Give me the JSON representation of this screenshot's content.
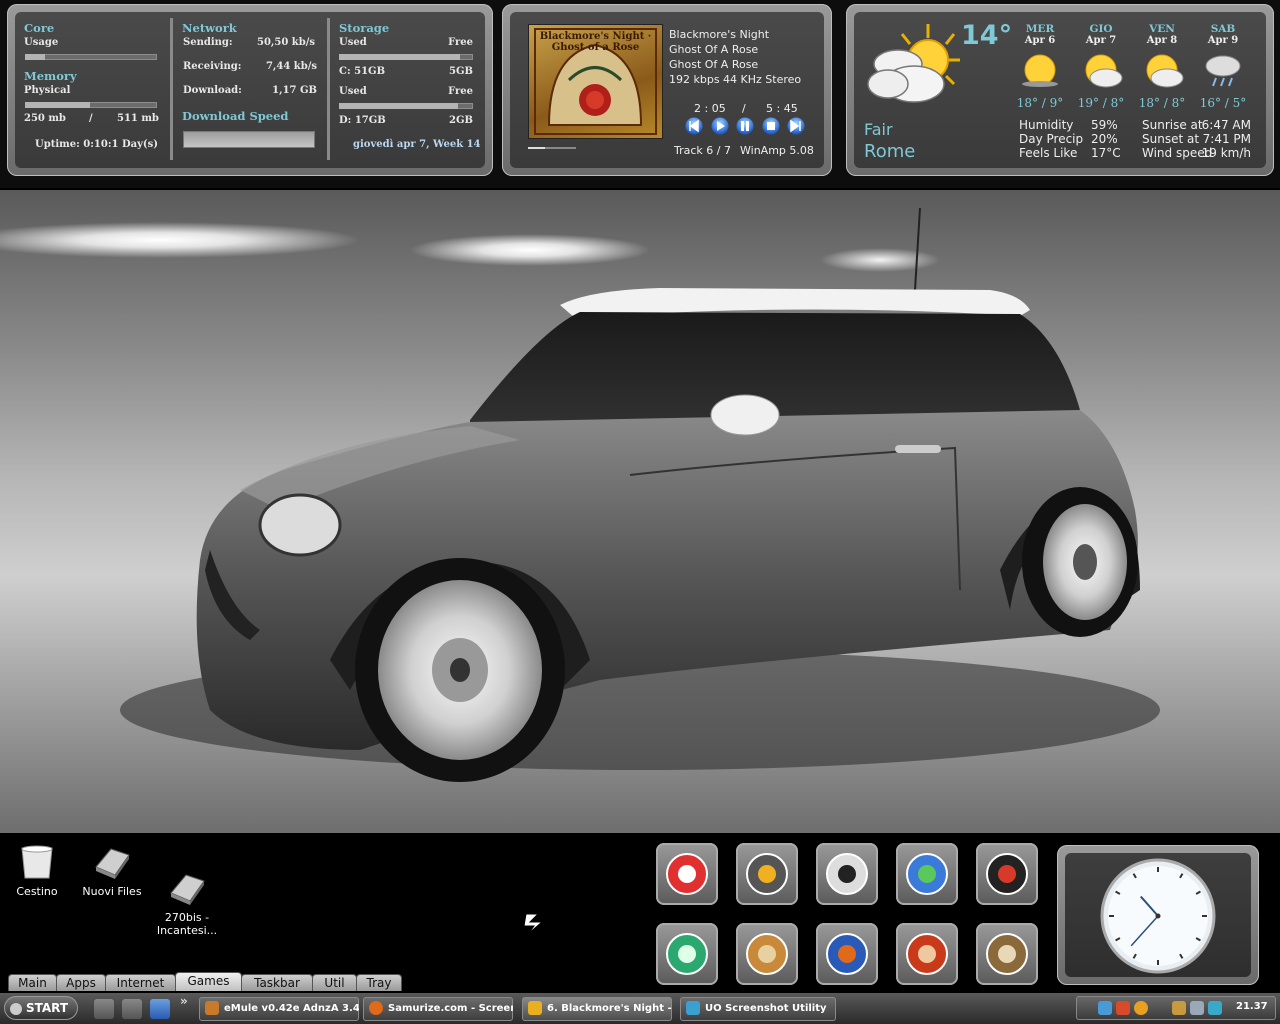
{
  "system": {
    "core_title": "Core",
    "usage_label": "Usage",
    "usage_fraction": 0.15,
    "memory_title": "Memory",
    "physical_label": "Physical",
    "memory_fraction": 0.49,
    "mem_used": "250 mb",
    "mem_sep": "/",
    "mem_total": "511 mb",
    "uptime": "Uptime: 0:10:1 Day(s)"
  },
  "network": {
    "title": "Network",
    "sending_label": "Sending:",
    "sending_value": "50,50 kb/s",
    "receiving_label": "Receiving:",
    "receiving_value": "7,44 kb/s",
    "download_label": "Download:",
    "download_value": "1,17 GB",
    "speed_title": "Download Speed"
  },
  "storage": {
    "title": "Storage",
    "c_used_label": "Used",
    "c_free_label": "Free",
    "c_fraction": 0.9,
    "c_used": "C:  51GB",
    "c_free": "5GB",
    "d_used_label": "Used",
    "d_free_label": "Free",
    "d_fraction": 0.89,
    "d_used": "D:  17GB",
    "d_free": "2GB",
    "date": "giovedì apr 7, Week 14"
  },
  "music": {
    "album_art_caption": "Blackmore's Night · Ghost of a Rose",
    "artist": "Blackmore's Night",
    "album": "Ghost Of A Rose",
    "song": "Ghost Of A Rose",
    "quality": "192 kbps 44 KHz Stereo",
    "elapsed": "2 : 05",
    "time_sep": "/",
    "total": "5 : 45",
    "track": "Track 6 / 7",
    "player": "WinAmp 5.08",
    "progress_fraction": 0.36
  },
  "weather": {
    "temp": "14°",
    "condition": "Fair",
    "city": "Rome",
    "forecast": [
      {
        "day": "MER",
        "date": "Apr 6",
        "temps": "18° / 9°"
      },
      {
        "day": "GIO",
        "date": "Apr 7",
        "temps": "19° / 8°"
      },
      {
        "day": "VEN",
        "date": "Apr 8",
        "temps": "18° / 8°"
      },
      {
        "day": "SAB",
        "date": "Apr 9",
        "temps": "16° / 5°"
      }
    ],
    "details": [
      {
        "label": "Humidity",
        "value": "59%",
        "label2": "Sunrise at",
        "value2": "6:47 AM"
      },
      {
        "label": "Day Precip",
        "value": "20%",
        "label2": "Sunset at",
        "value2": "7:41 PM"
      },
      {
        "label": "Feels Like",
        "value": "17°C",
        "label2": "Wind speed",
        "value2": "19 km/h"
      }
    ]
  },
  "desktop_icons": [
    {
      "label": "Cestino"
    },
    {
      "label": "Nuovi Files"
    },
    {
      "label": "270bis -\nIncantesi..."
    }
  ],
  "launcher_icons": [
    "power-icon",
    "winamp-icon",
    "info-icon",
    "messenger-icon",
    "nfs-icon",
    "refresh-icon",
    "rome-game-icon",
    "firefox-icon",
    "mail-icon",
    "emule-icon"
  ],
  "tabs": [
    "Main",
    "Apps",
    "Internet",
    "Games",
    "Taskbar",
    "Util",
    "Tray"
  ],
  "taskbar": {
    "start": "START",
    "windows": [
      {
        "label": "eMule v0.42e AdnzA 3.4"
      },
      {
        "label": "Samurize.com - Screen..."
      },
      {
        "label": "6. Blackmore's Night -..."
      },
      {
        "label": "UO Screenshot Utility"
      }
    ],
    "clock": "21.37"
  },
  "clock_widget": {
    "hour": 10,
    "minute": 37
  }
}
